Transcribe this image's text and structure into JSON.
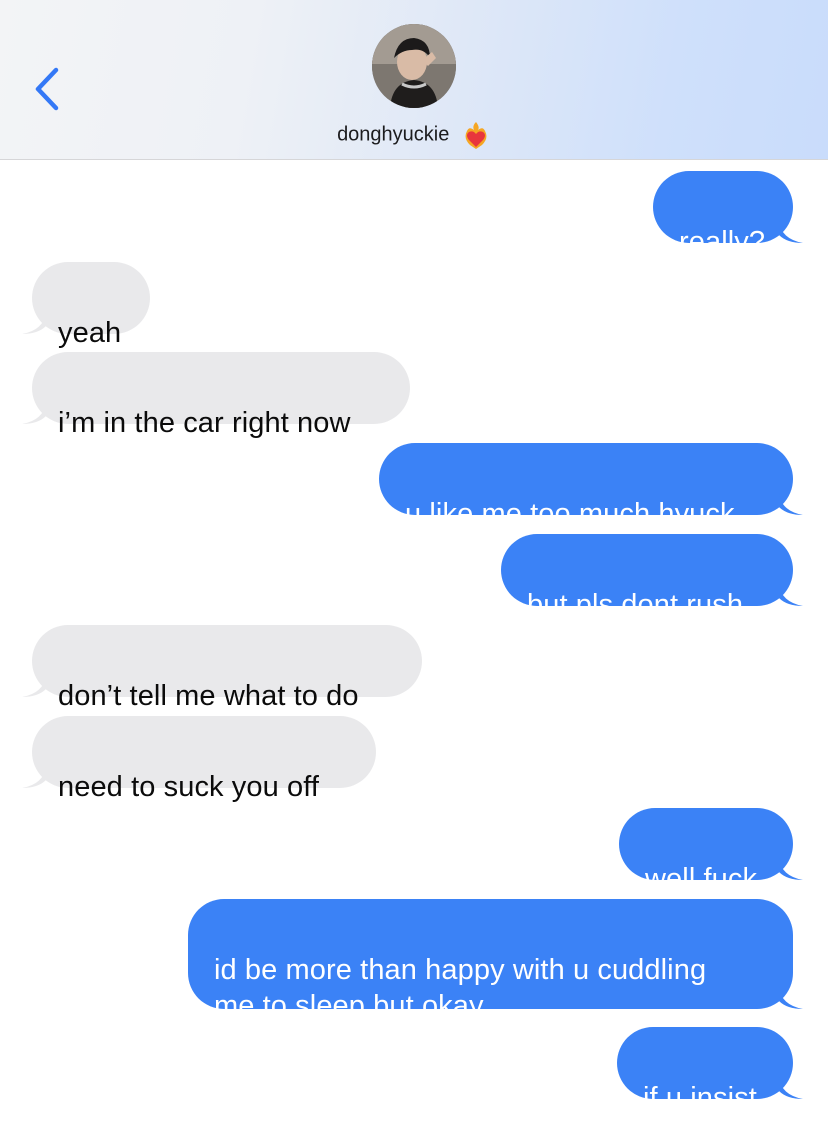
{
  "header": {
    "contact_name": "donghyuckie",
    "emoji_icon": "heart-on-fire-emoji",
    "back_icon": "chevron-left-icon",
    "accent": "#3478f6"
  },
  "colors": {
    "outgoing_bubble": "#3b82f6",
    "incoming_bubble": "#e9e9eb"
  },
  "messages": [
    {
      "dir": "out",
      "text": "really?"
    },
    {
      "dir": "in",
      "text": "yeah"
    },
    {
      "dir": "in",
      "text": "i’m in the car right now"
    },
    {
      "dir": "out",
      "text": "u like me too much hyuck"
    },
    {
      "dir": "out",
      "text": "but pls dont rush"
    },
    {
      "dir": "in",
      "text": "don’t tell me what to do"
    },
    {
      "dir": "in",
      "text": "need to suck you off"
    },
    {
      "dir": "out",
      "text": "well fuck"
    },
    {
      "dir": "out",
      "text": "id be more than happy with u cuddling\nme to sleep but okay"
    },
    {
      "dir": "out",
      "text": "if u insist"
    }
  ]
}
